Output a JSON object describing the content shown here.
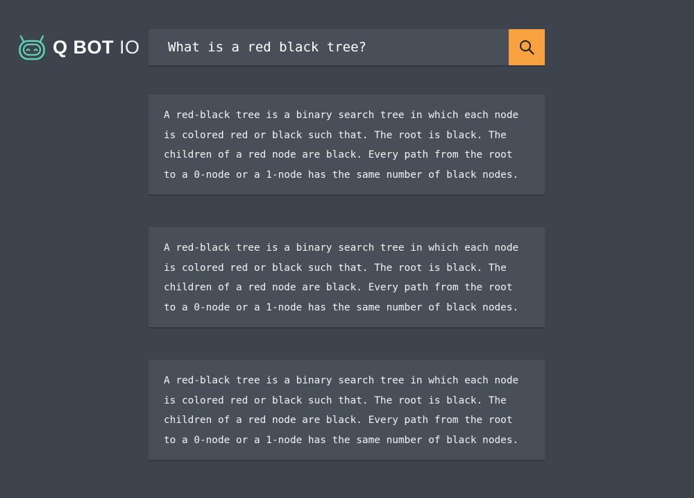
{
  "brand": {
    "name_bold": "Q BOT",
    "name_light": "IO",
    "icon": "robot-icon",
    "accent_color": "#5fd3b8"
  },
  "search": {
    "value": "What is a red black tree?",
    "button_icon": "search-icon",
    "button_color": "#f8a23f"
  },
  "answers": [
    {
      "text": "A red-black tree is a binary search tree in which each node is colored red or black such that. The root is black. The children of a red node are black. Every path from the root to a 0-node or a 1-node has the same number of black nodes."
    },
    {
      "text": "A red-black tree is a binary search tree in which each node is colored red or black such that. The root is black. The children of a red node are black. Every path from the root to a 0-node or a 1-node has the same number of black nodes."
    },
    {
      "text": "A red-black tree is a binary search tree in which each node is colored red or black such that. The root is black. The children of a red node are black. Every path from the root to a 0-node or a 1-node has the same number of black nodes."
    }
  ]
}
